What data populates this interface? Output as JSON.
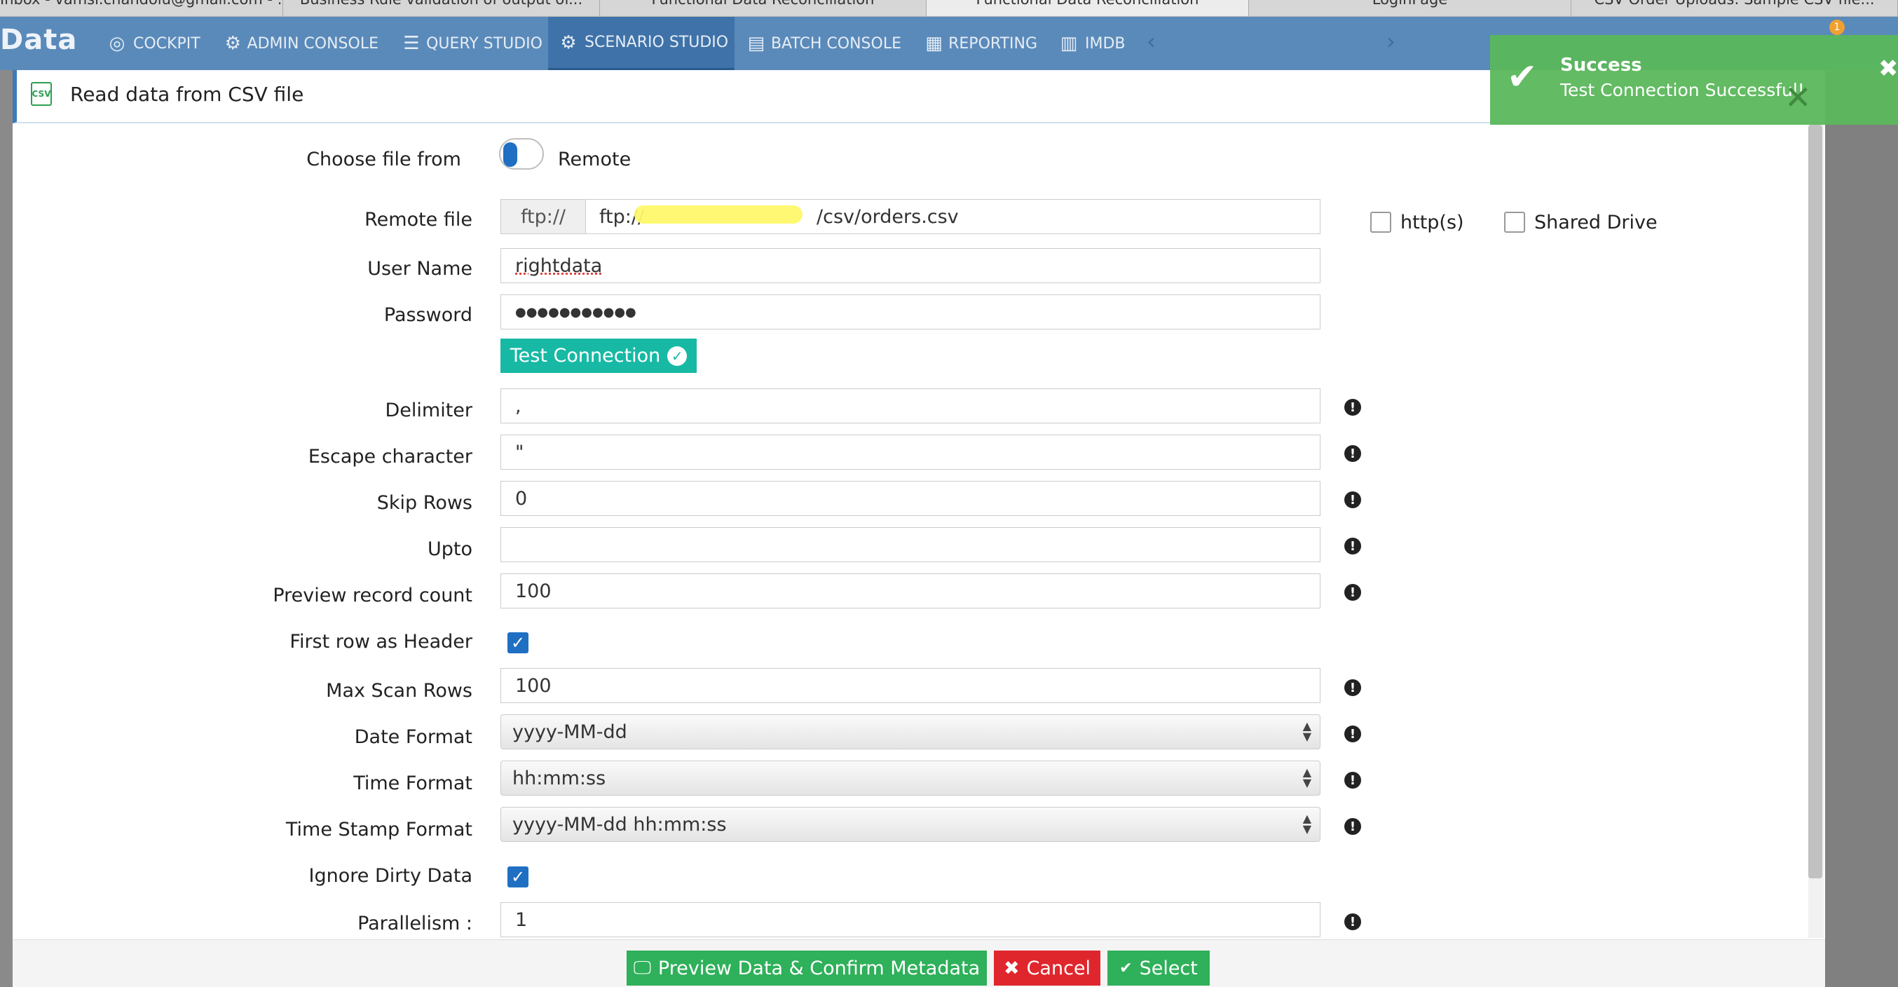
{
  "browser_tabs": [
    {
      "label": "Inbox - vamsi.chandolu@gmail.com - ..."
    },
    {
      "label": "Business Rule validation of output of..."
    },
    {
      "label": "Functional Data Reconciliation"
    },
    {
      "label": "Functional Data Reconciliation"
    },
    {
      "label": "LoginPage"
    },
    {
      "label": "CSV Order Uploads: Sample CSV file..."
    }
  ],
  "app": {
    "logo": "Data"
  },
  "nav": [
    {
      "label": "COCKPIT",
      "icon": "cockpit-icon"
    },
    {
      "label": "ADMIN CONSOLE",
      "icon": "gear-icon"
    },
    {
      "label": "QUERY STUDIO",
      "icon": "database-icon"
    },
    {
      "label": "SCENARIO STUDIO",
      "icon": "scenario-icon",
      "active": true
    },
    {
      "label": "BATCH CONSOLE",
      "icon": "batch-icon"
    },
    {
      "label": "REPORTING",
      "icon": "report-icon"
    },
    {
      "label": "IMDB",
      "icon": "imdb-icon"
    }
  ],
  "notifications_count": "1",
  "modal": {
    "title": "Read data from CSV file",
    "icon": "csv-file-icon",
    "icon_text": "CSV"
  },
  "form": {
    "choose_file_label": "Choose file from",
    "toggle_value": "Remote",
    "remote_file_label": "Remote file",
    "remote_file_prefix": "ftp://",
    "remote_file_value": "ftp://",
    "remote_file_suffix": "/csv/orders.csv",
    "https_label": "http(s)",
    "shared_drive_label": "Shared Drive",
    "username_label": "User Name",
    "username_value": "rightdata",
    "password_label": "Password",
    "password_value": "●●●●●●●●●●●",
    "test_connection_label": "Test Connection",
    "delimiter_label": "Delimiter",
    "delimiter_value": ",",
    "escape_label": "Escape character",
    "escape_value": "\"",
    "skip_rows_label": "Skip Rows",
    "skip_rows_value": "0",
    "upto_label": "Upto",
    "upto_value": "",
    "preview_count_label": "Preview record count",
    "preview_count_value": "100",
    "first_row_header_label": "First row as Header",
    "first_row_header_checked": true,
    "max_scan_label": "Max Scan Rows",
    "max_scan_value": "100",
    "date_format_label": "Date Format",
    "date_format_value": "yyyy-MM-dd",
    "time_format_label": "Time Format",
    "time_format_value": "hh:mm:ss",
    "timestamp_format_label": "Time Stamp Format",
    "timestamp_format_value": "yyyy-MM-dd hh:mm:ss",
    "ignore_dirty_label": "Ignore Dirty Data",
    "ignore_dirty_checked": true,
    "parallelism_label": "Parallelism :",
    "parallelism_value": "1"
  },
  "footer": {
    "preview_button": "Preview Data & Confirm Metadata",
    "cancel_button": "Cancel",
    "select_button": "Select"
  },
  "toast": {
    "title": "Success",
    "message": "Test Connection Successful!"
  },
  "colors": {
    "nav_bg": "#5a8aba",
    "teal_button": "#17b9a4",
    "green_button": "#2fb05a",
    "red_button": "#e0262d",
    "toast_green": "#5bb75b",
    "checkbox_blue": "#1f6fc2"
  }
}
